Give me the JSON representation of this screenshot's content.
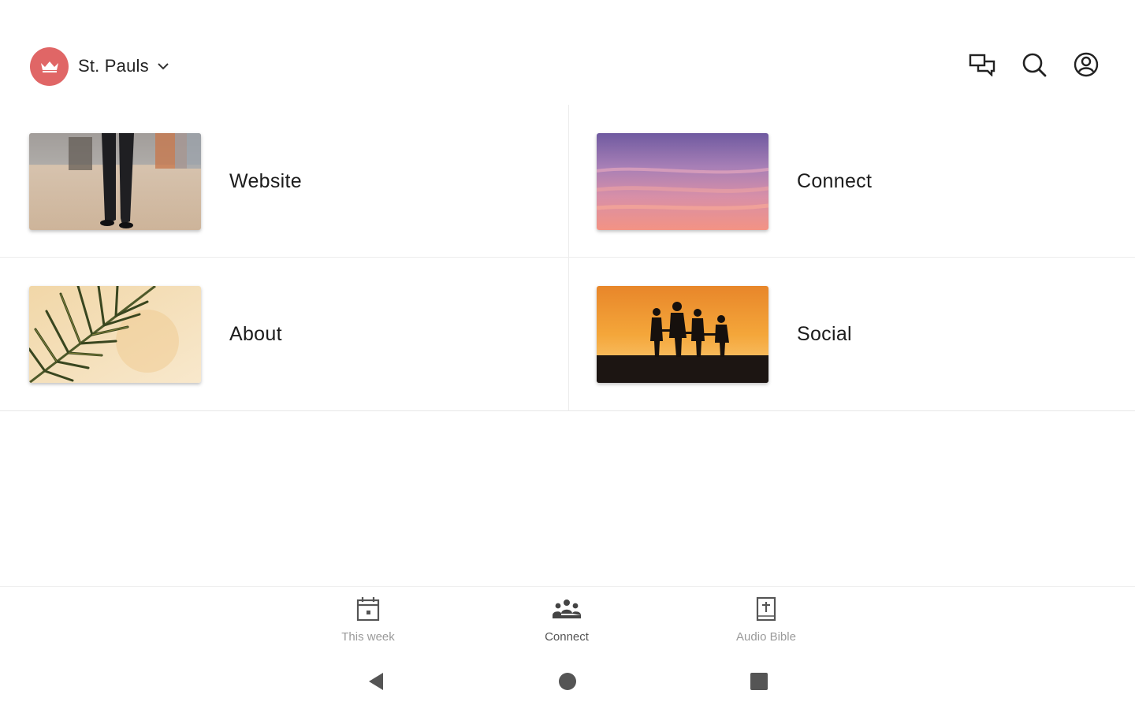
{
  "header": {
    "church_name": "St. Pauls",
    "logo_icon": "crown-icon",
    "logo_color": "#e06666",
    "actions": [
      {
        "name": "chat-icon"
      },
      {
        "name": "search-icon"
      },
      {
        "name": "account-icon"
      }
    ]
  },
  "tiles": [
    {
      "label": "Website",
      "image": "walking-person-photo"
    },
    {
      "label": "Connect",
      "image": "sunset-sky-photo"
    },
    {
      "label": "About",
      "image": "palm-leaf-photo"
    },
    {
      "label": "Social",
      "image": "family-silhouette-sunset-photo"
    }
  ],
  "bottom_nav": {
    "items": [
      {
        "label": "This week",
        "icon": "calendar-icon",
        "active": false
      },
      {
        "label": "Connect",
        "icon": "people-icon",
        "active": true
      },
      {
        "label": "Audio Bible",
        "icon": "bible-icon",
        "active": false
      }
    ]
  },
  "system_nav": {
    "back": "back-triangle-icon",
    "home": "home-circle-icon",
    "recents": "recents-square-icon"
  }
}
